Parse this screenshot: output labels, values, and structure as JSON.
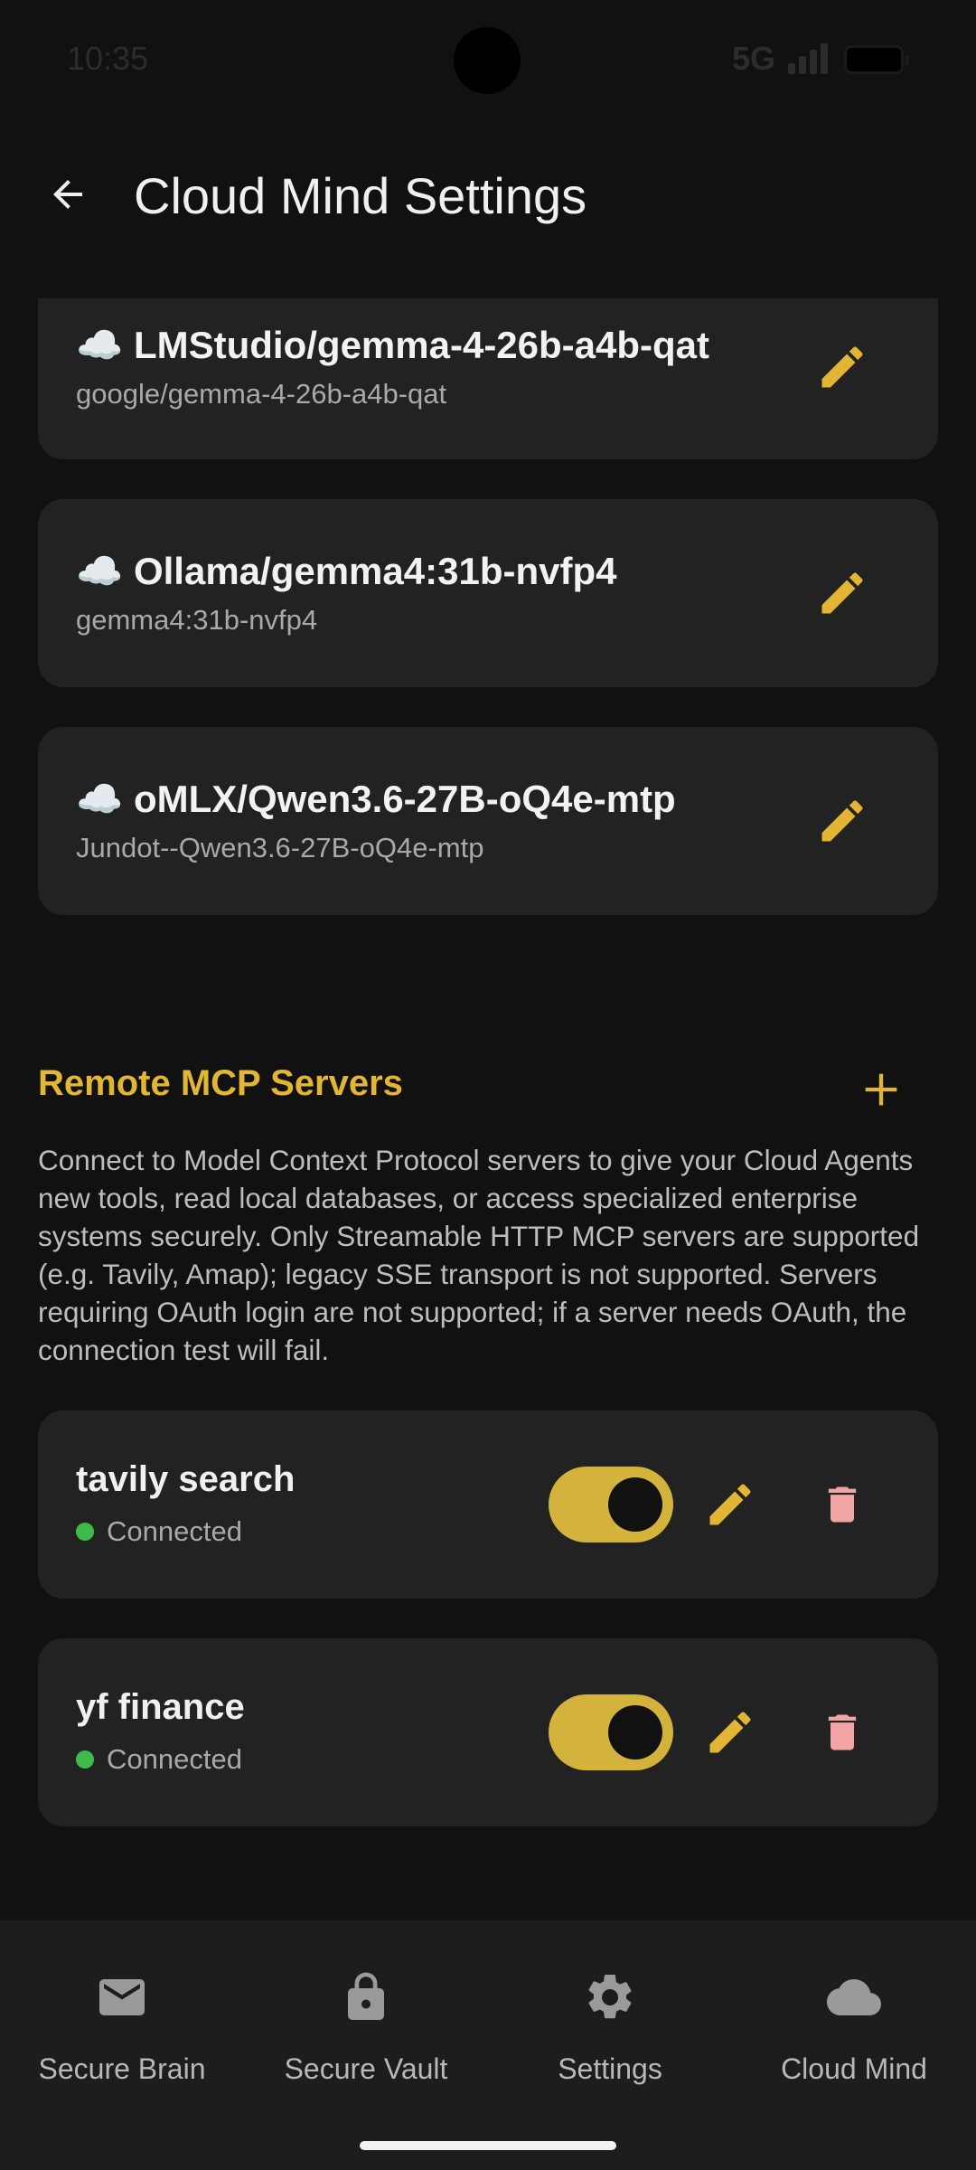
{
  "status_bar": {
    "time": "10:35",
    "network": "5G"
  },
  "app_bar": {
    "title": "Cloud Mind Settings"
  },
  "models": [
    {
      "title": "☁️ LMStudio/gemma-4-26b-a4b-qat",
      "subtitle": "google/gemma-4-26b-a4b-qat"
    },
    {
      "title": "☁️ Ollama/gemma4:31b-nvfp4",
      "subtitle": "gemma4:31b-nvfp4"
    },
    {
      "title": "☁️ oMLX/Qwen3.6-27B-oQ4e-mtp",
      "subtitle": "Jundot--Qwen3.6-27B-oQ4e-mtp"
    }
  ],
  "mcp_section": {
    "title": "Remote MCP Servers",
    "description": "Connect to Model Context Protocol servers to give your Cloud Agents new tools, read local databases, or access specialized enterprise systems securely. Only Streamable HTTP MCP servers are supported (e.g. Tavily, Amap); legacy SSE transport is not supported. Servers requiring OAuth login are not supported; if a server needs OAuth, the connection test will fail.",
    "servers": [
      {
        "name": "tavily search",
        "status": "Connected",
        "enabled": true
      },
      {
        "name": "yf finance",
        "status": "Connected",
        "enabled": true
      }
    ]
  },
  "bottom_nav": {
    "items": [
      {
        "label": "Secure Brain",
        "icon": "mail-icon"
      },
      {
        "label": "Secure Vault",
        "icon": "lock-icon"
      },
      {
        "label": "Settings",
        "icon": "gear-icon"
      },
      {
        "label": "Cloud Mind",
        "icon": "cloud-icon"
      }
    ]
  },
  "colors": {
    "accent": "#E2B534",
    "background": "#111111",
    "card": "#222222",
    "status_ok": "#3DBB4A",
    "delete": "#F2A5A5"
  }
}
